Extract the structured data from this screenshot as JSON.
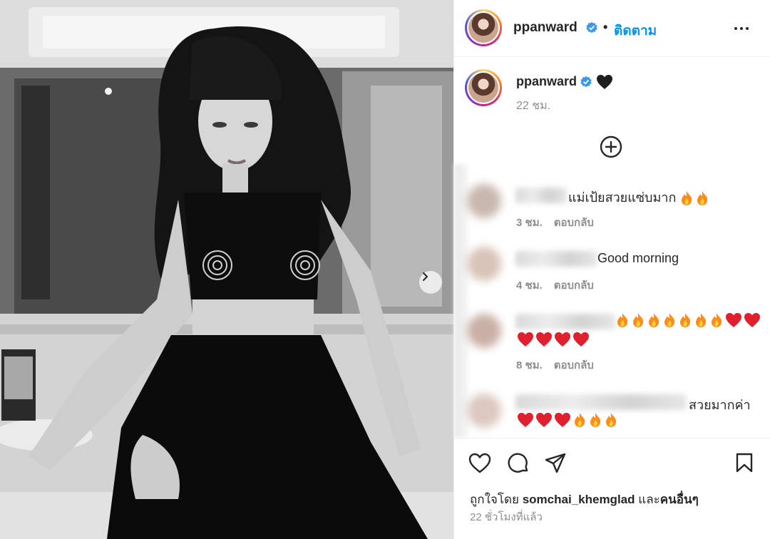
{
  "post": {
    "author": "ppanward",
    "follow_label": "ติดตาม",
    "separator": "•",
    "caption_time": "22 ชม.",
    "icons": {
      "verified": "verified-badge-icon",
      "heart_emoji": "black-heart-emoji",
      "more": "more-options-icon",
      "add": "plus-circle-icon",
      "next": "chevron-right-icon"
    }
  },
  "comments": [
    {
      "text": "แม่เป้ยสวยแซ่บมาก",
      "emoji_after": [
        "fire",
        "fire"
      ],
      "emoji_line2": [],
      "time": "3 ชม.",
      "reply": "ตอบกลับ"
    },
    {
      "text": "Good morning",
      "emoji_after": [],
      "emoji_line2": [],
      "time": "4 ชม.",
      "reply": "ตอบกลับ"
    },
    {
      "text": "",
      "emoji_after": [
        "fire",
        "fire",
        "fire",
        "fire",
        "fire",
        "fire",
        "fire",
        "red-heart",
        "red-heart"
      ],
      "emoji_line2": [
        "red-heart",
        "red-heart",
        "red-heart",
        "red-heart"
      ],
      "time": "8 ชม.",
      "reply": "ตอบกลับ"
    },
    {
      "text": "สวยมากค่า",
      "emoji_after": [],
      "emoji_line2": [
        "red-heart",
        "red-heart",
        "red-heart",
        "fire",
        "fire",
        "fire"
      ],
      "time": "",
      "reply": ""
    }
  ],
  "actions": {
    "like_icon": "heart-outline-icon",
    "comment_icon": "comment-bubble-icon",
    "share_icon": "paper-plane-icon",
    "save_icon": "bookmark-icon",
    "liked_by_prefix": "ถูกใจโดย",
    "liked_by_user": "somchai_khemglad",
    "liked_by_conj": "และ",
    "liked_by_others": "คนอื่นๆ",
    "post_time": "22 ชั่วโมงที่แล้ว"
  },
  "colors": {
    "link_blue": "#0095f6",
    "verified_blue": "#3897f0",
    "text": "#262626",
    "muted": "#8e8e8e",
    "fire": "#ff8c1a",
    "heart_red": "#e0202e"
  }
}
